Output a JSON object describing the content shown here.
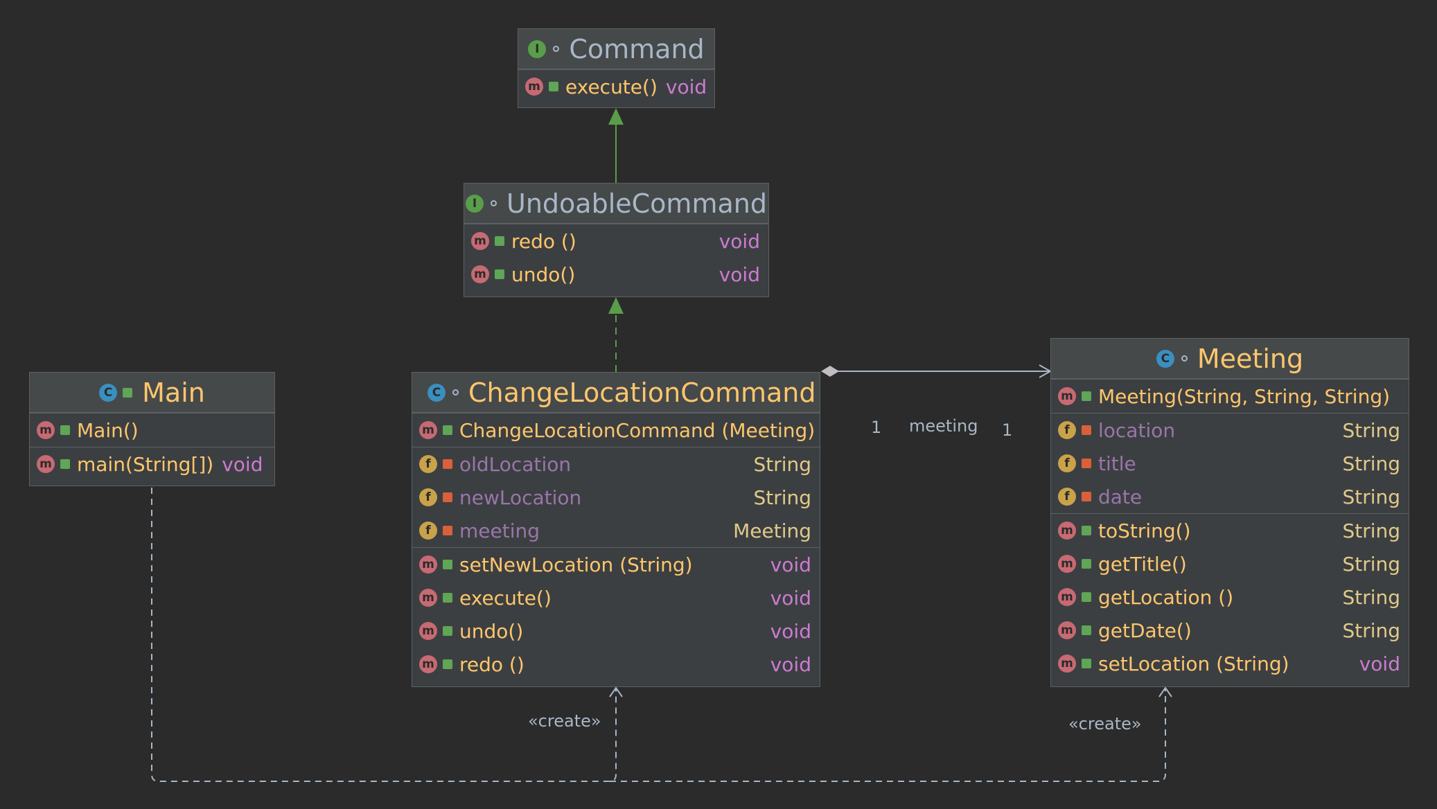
{
  "diagram": {
    "classes": {
      "command": {
        "kind": "interface",
        "name": "Command",
        "methods": [
          {
            "name": "execute()",
            "type": "void"
          }
        ]
      },
      "undoable": {
        "kind": "interface",
        "name": "UndoableCommand",
        "methods": [
          {
            "name": "redo ()",
            "type": "void"
          },
          {
            "name": "undo()",
            "type": "void"
          }
        ]
      },
      "main": {
        "kind": "class",
        "name": "Main",
        "methods": [
          {
            "name": "Main()",
            "type": ""
          },
          {
            "name": "main(String[])",
            "type": "void"
          }
        ]
      },
      "change": {
        "kind": "class",
        "name": "ChangeLocationCommand",
        "constructor": {
          "name": "ChangeLocationCommand (Meeting)"
        },
        "fields": [
          {
            "name": "oldLocation",
            "type": "String"
          },
          {
            "name": "newLocation",
            "type": "String"
          },
          {
            "name": "meeting",
            "type": "Meeting"
          }
        ],
        "methods": [
          {
            "name": "setNewLocation (String)",
            "type": "void"
          },
          {
            "name": "execute()",
            "type": "void"
          },
          {
            "name": "undo()",
            "type": "void"
          },
          {
            "name": "redo ()",
            "type": "void"
          }
        ]
      },
      "meeting": {
        "kind": "class",
        "name": "Meeting",
        "constructor": {
          "name": "Meeting(String, String, String)"
        },
        "fields": [
          {
            "name": "location",
            "type": "String"
          },
          {
            "name": "title",
            "type": "String"
          },
          {
            "name": "date",
            "type": "String"
          }
        ],
        "methods": [
          {
            "name": "toString()",
            "type": "String"
          },
          {
            "name": "getTitle()",
            "type": "String"
          },
          {
            "name": "getLocation ()",
            "type": "String"
          },
          {
            "name": "getDate()",
            "type": "String"
          },
          {
            "name": "setLocation (String)",
            "type": "void"
          }
        ]
      }
    },
    "edges": {
      "assoc_label": "meeting",
      "assoc_mult_left": "1",
      "assoc_mult_right": "1",
      "create_label_1": "«create»",
      "create_label_2": "«create»"
    },
    "icons": {
      "interface": "interface-icon",
      "class": "class-icon",
      "method": "method-icon",
      "field": "field-icon",
      "public": "public-lock-icon",
      "private": "private-lock-icon"
    },
    "colors": {
      "background": "#2b2b2b",
      "node": "#3c3f41",
      "method_name": "#ffc66d",
      "field_name": "#9876aa",
      "void_type": "#cc7bd2",
      "inheritance_arrow": "#5a9e4b"
    }
  }
}
